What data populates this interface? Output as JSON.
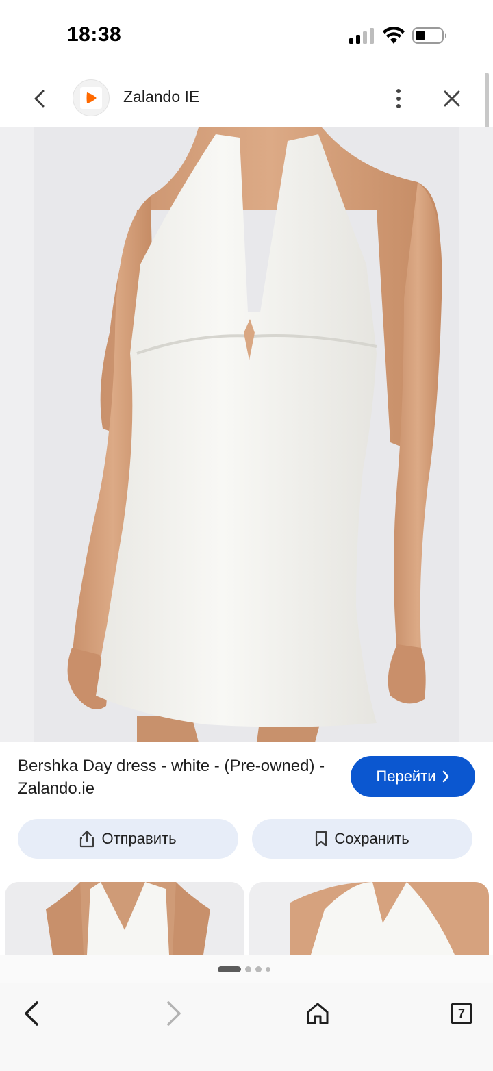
{
  "status_bar": {
    "time": "18:38",
    "icons": [
      "signal-icon",
      "wifi-icon",
      "battery-icon"
    ]
  },
  "header": {
    "site_name": "Zalando IE",
    "icons": [
      "chevron-left-icon",
      "zalando-logo-icon",
      "more-vert-icon",
      "close-icon"
    ]
  },
  "image": {
    "description_icon": "product-photo"
  },
  "result": {
    "title": "Bershka Day dress - white - (Pre-owned) - Zalando.ie",
    "visit_label": "Перейти"
  },
  "actions": {
    "share_label": "Отправить",
    "save_label": "Сохранить"
  },
  "pager": {
    "pages": 4,
    "current": 1
  },
  "bottom_nav": {
    "tab_count": "7",
    "icons": [
      "back-arrow-icon",
      "forward-arrow-icon",
      "home-icon",
      "tabs-icon"
    ]
  },
  "colors": {
    "accent": "#0b57d0",
    "tonal_button": "#e7edf8",
    "zalando_orange": "#ff6900"
  }
}
